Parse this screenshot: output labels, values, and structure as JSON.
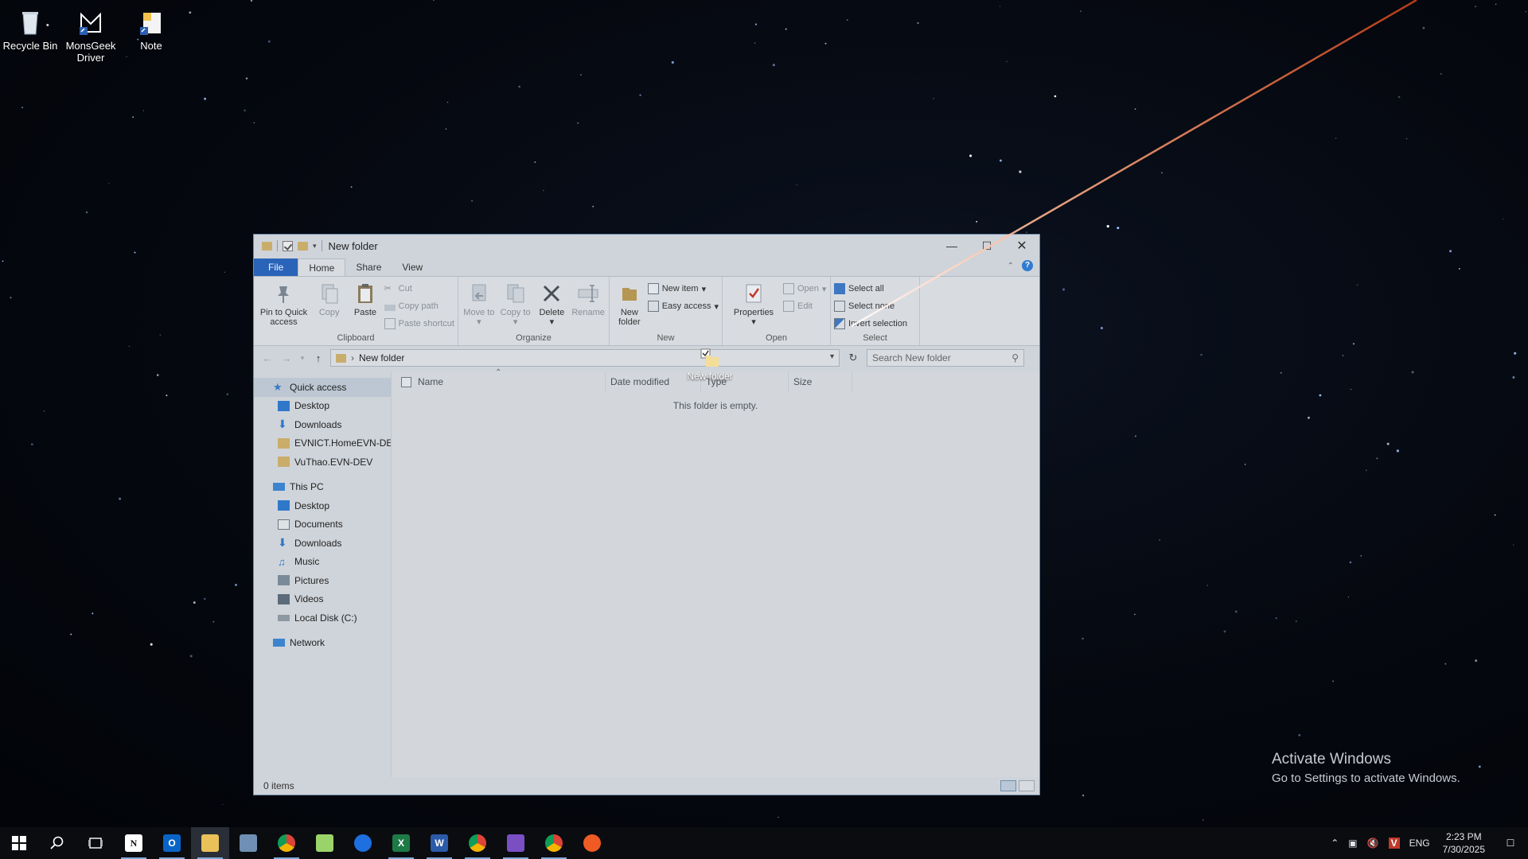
{
  "desktop": {
    "icons": [
      {
        "label": "Recycle Bin"
      },
      {
        "label": "MonsGeek Driver"
      },
      {
        "label": "Note"
      }
    ],
    "watermark": {
      "title": "Activate Windows",
      "subtitle": "Go to Settings to activate Windows."
    }
  },
  "explorer": {
    "title": "New folder",
    "tabs": {
      "file": "File",
      "home": "Home",
      "share": "Share",
      "view": "View"
    },
    "ribbon": {
      "clipboard": {
        "label": "Clipboard",
        "pin": "Pin to Quick access",
        "copy": "Copy",
        "paste": "Paste",
        "cut": "Cut",
        "copy_path": "Copy path",
        "paste_shortcut": "Paste shortcut"
      },
      "organize": {
        "label": "Organize",
        "move_to": "Move to",
        "copy_to": "Copy to",
        "delete": "Delete",
        "rename": "Rename"
      },
      "new": {
        "label": "New",
        "new_folder": "New folder",
        "new_item": "New item",
        "easy_access": "Easy access"
      },
      "open": {
        "label": "Open",
        "properties": "Properties",
        "open": "Open",
        "edit": "Edit"
      },
      "select": {
        "label": "Select",
        "select_all": "Select all",
        "select_none": "Select none",
        "invert": "Invert selection"
      }
    },
    "address": {
      "path": "New folder",
      "search_placeholder": "Search New folder"
    },
    "nav": {
      "quick_access": "Quick access",
      "quick_items": [
        "Desktop",
        "Downloads",
        "EVNICT.HomeEVN-DEV",
        "VuThao.EVN-DEV"
      ],
      "this_pc": "This PC",
      "pc_items": [
        "Desktop",
        "Documents",
        "Downloads",
        "Music",
        "Pictures",
        "Videos",
        "Local Disk (C:)"
      ],
      "network": "Network"
    },
    "columns": [
      "Name",
      "Date modified",
      "Type",
      "Size"
    ],
    "empty_message": "This folder is empty.",
    "status": "0 items",
    "drag_label": "New folder"
  },
  "taskbar": {
    "language": "ENG",
    "time": "2:23 PM",
    "date": "7/30/2025",
    "accent": "#7fa8d8"
  }
}
